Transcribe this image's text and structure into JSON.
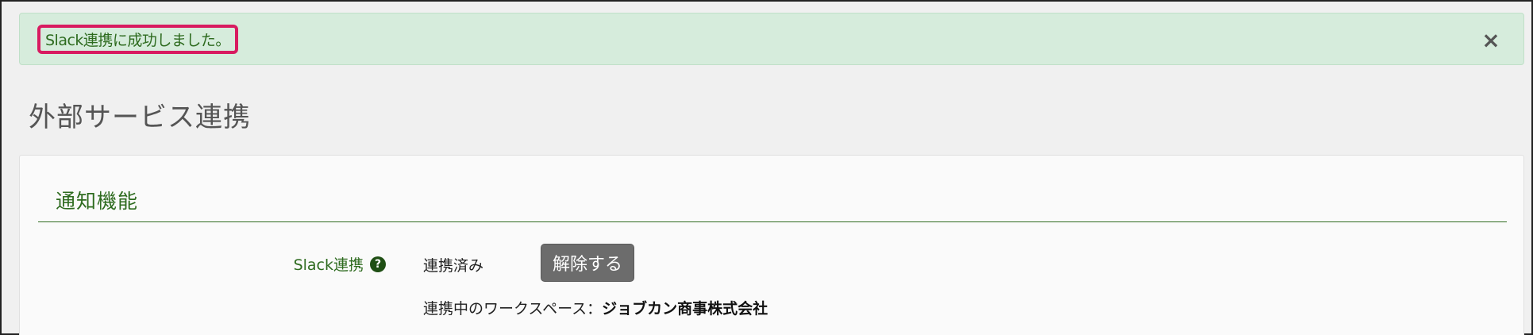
{
  "alert": {
    "message": "Slack連携に成功しました。",
    "close_symbol": "×"
  },
  "page": {
    "title": "外部サービス連携"
  },
  "section": {
    "title": "通知機能"
  },
  "slack_field": {
    "label": "Slack連携",
    "help_symbol": "?",
    "status": "連携済み",
    "unlink_button_label": "解除する",
    "workspace_label": "連携中のワークスペース：",
    "workspace_name": "ジョブカン商事株式会社"
  },
  "colors": {
    "accent_green": "#2e6b1f",
    "alert_background": "#d6ecdc",
    "highlight_border": "#d81b60",
    "button_gray": "#6c6c6c"
  },
  "icons": {
    "close": "close-icon",
    "help": "help-icon"
  }
}
